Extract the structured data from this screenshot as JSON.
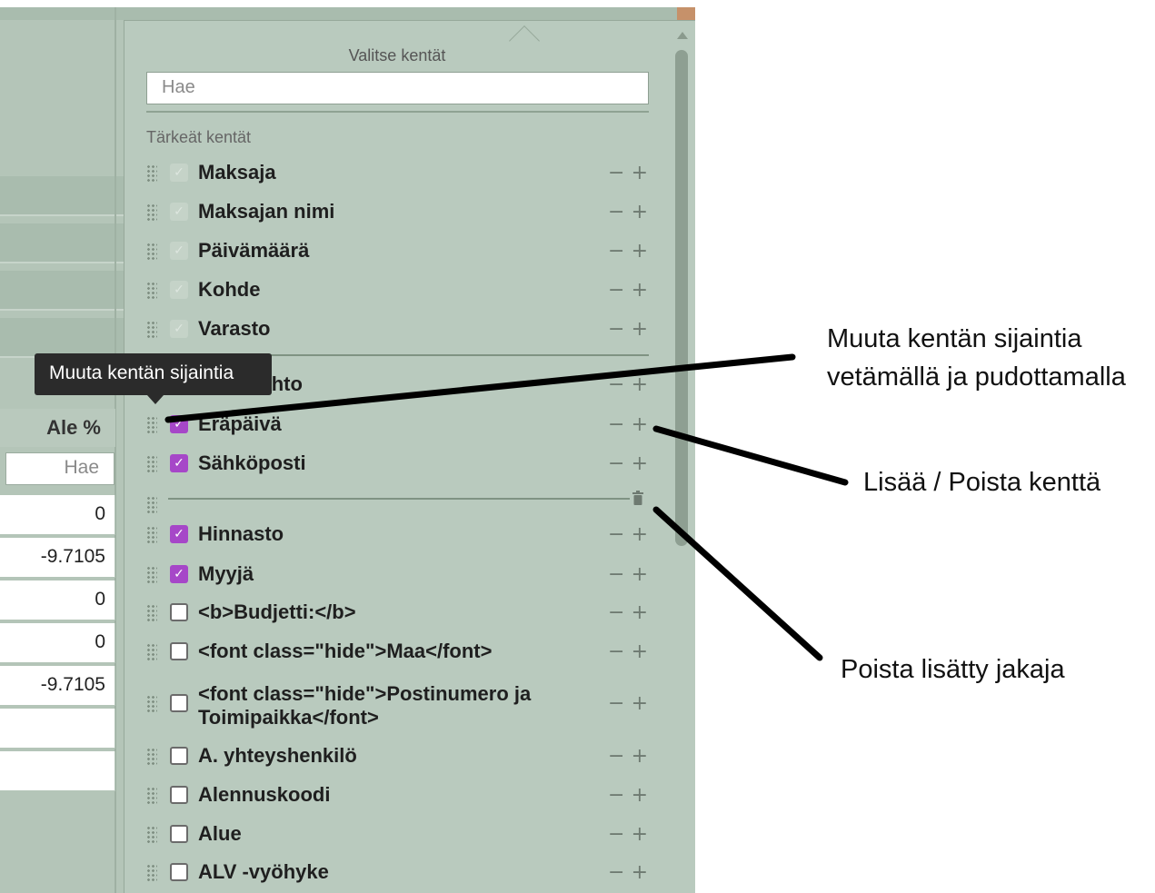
{
  "background_table": {
    "column_header": "Ale %",
    "search_placeholder": "Hae",
    "cells": [
      "0",
      "-9.7105",
      "0",
      "0",
      "-9.7105",
      "",
      ""
    ]
  },
  "panel": {
    "title": "Valitse kentät",
    "search_placeholder": "Hae",
    "section_label": "Tärkeät kentät",
    "important_fields": [
      {
        "label": "Maksaja",
        "state": "locked"
      },
      {
        "label": "Maksajan nimi",
        "state": "locked"
      },
      {
        "label": "Päivämäärä",
        "state": "locked"
      },
      {
        "label": "Kohde",
        "state": "locked"
      },
      {
        "label": "Varasto",
        "state": "locked"
      }
    ],
    "fields": [
      {
        "label": "Maksuehto",
        "state": "checked"
      },
      {
        "label": "Eräpäivä",
        "state": "checked"
      },
      {
        "label": "Sähköposti",
        "state": "checked"
      },
      {
        "label": "Hinnasto",
        "state": "checked"
      },
      {
        "label": "Myyjä",
        "state": "checked"
      },
      {
        "label": "<b>Budjetti:</b>",
        "state": "unchecked"
      },
      {
        "label": "<font class=\"hide\">Maa</font>",
        "state": "unchecked"
      },
      {
        "label": "<font class=\"hide\">Postinumero ja Toimipaikka</font>",
        "state": "unchecked"
      },
      {
        "label": "A. yhteyshenkilö",
        "state": "unchecked"
      },
      {
        "label": "Alennuskoodi",
        "state": "unchecked"
      },
      {
        "label": "Alue",
        "state": "unchecked"
      },
      {
        "label": "ALV -vyöhyke",
        "state": "unchecked"
      }
    ],
    "minus_glyph": "−",
    "plus_glyph": "+",
    "checkmark_glyph": "✓"
  },
  "tooltip": {
    "text": "Muuta kentän sijaintia"
  },
  "callouts": {
    "drag": "Muuta kentän sijaintia vetämällä ja pudottamalla",
    "add_remove": "Lisää / Poista kenttä",
    "remove_divider": "Poista lisätty jakaja"
  },
  "colors": {
    "panel_bg": "#b9cabe",
    "checkbox_checked": "#a647c8",
    "tooltip_bg": "#2b2b2b"
  },
  "icons": [
    "drag-handle-icon",
    "checkbox-icon",
    "minus-icon",
    "plus-icon",
    "trash-icon",
    "scroll-up-arrow-icon"
  ]
}
